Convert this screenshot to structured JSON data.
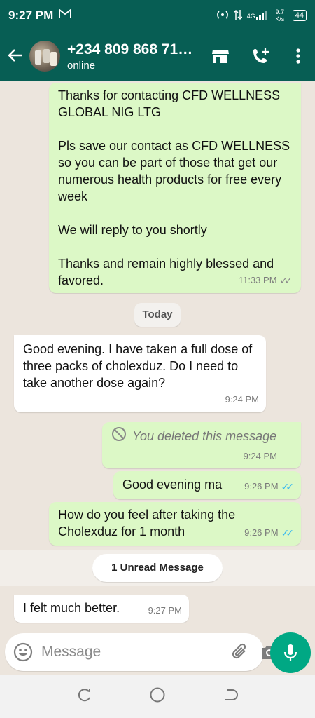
{
  "status_bar": {
    "time": "9:27 PM",
    "network": "4G",
    "speed": "9.7 K/s",
    "battery": "44"
  },
  "header": {
    "contact_name": "+234 809 868 71…",
    "contact_status": "online",
    "icons": [
      "back-arrow-icon",
      "avatar",
      "store-icon",
      "add-call-icon",
      "more-vert-icon"
    ]
  },
  "messages": [
    {
      "direction": "outgoing",
      "paragraphs": [
        "Thanks for contacting CFD WELLNESS GLOBAL NIG LTG",
        "Pls save our contact as CFD WELLNESS so you can be part of those that get our numerous health products for free every week",
        "We will reply to you shortly",
        "Thanks and remain highly blessed and favored."
      ],
      "time": "11:33 PM",
      "ticks": "read-gray"
    },
    {
      "direction": "incoming",
      "text": "Good evening. I have taken a full dose of three packs of cholexduz. Do I need to take another dose again?",
      "time": "9:24 PM"
    },
    {
      "direction": "outgoing",
      "text": "You deleted this message",
      "time": "9:24 PM",
      "deleted": true
    },
    {
      "direction": "outgoing",
      "text": "Good evening ma",
      "time": "9:26 PM",
      "ticks": "read-blue"
    },
    {
      "direction": "outgoing",
      "text": "How do you feel after taking the Cholexduz for 1 month",
      "time": "9:26 PM",
      "ticks": "read-blue"
    },
    {
      "direction": "incoming",
      "text": "I felt much better.",
      "time": "9:27 PM"
    }
  ],
  "date_chip": "Today",
  "unread_chip": "1 Unread Message",
  "composer": {
    "placeholder": "Message"
  },
  "colors": {
    "header": "#075e54",
    "outgoing_bubble": "#dcf8c6",
    "incoming_bubble": "#ffffff",
    "chat_background": "#ece5dd",
    "read_tick": "#34b7f1",
    "mic_button": "#00a884"
  }
}
